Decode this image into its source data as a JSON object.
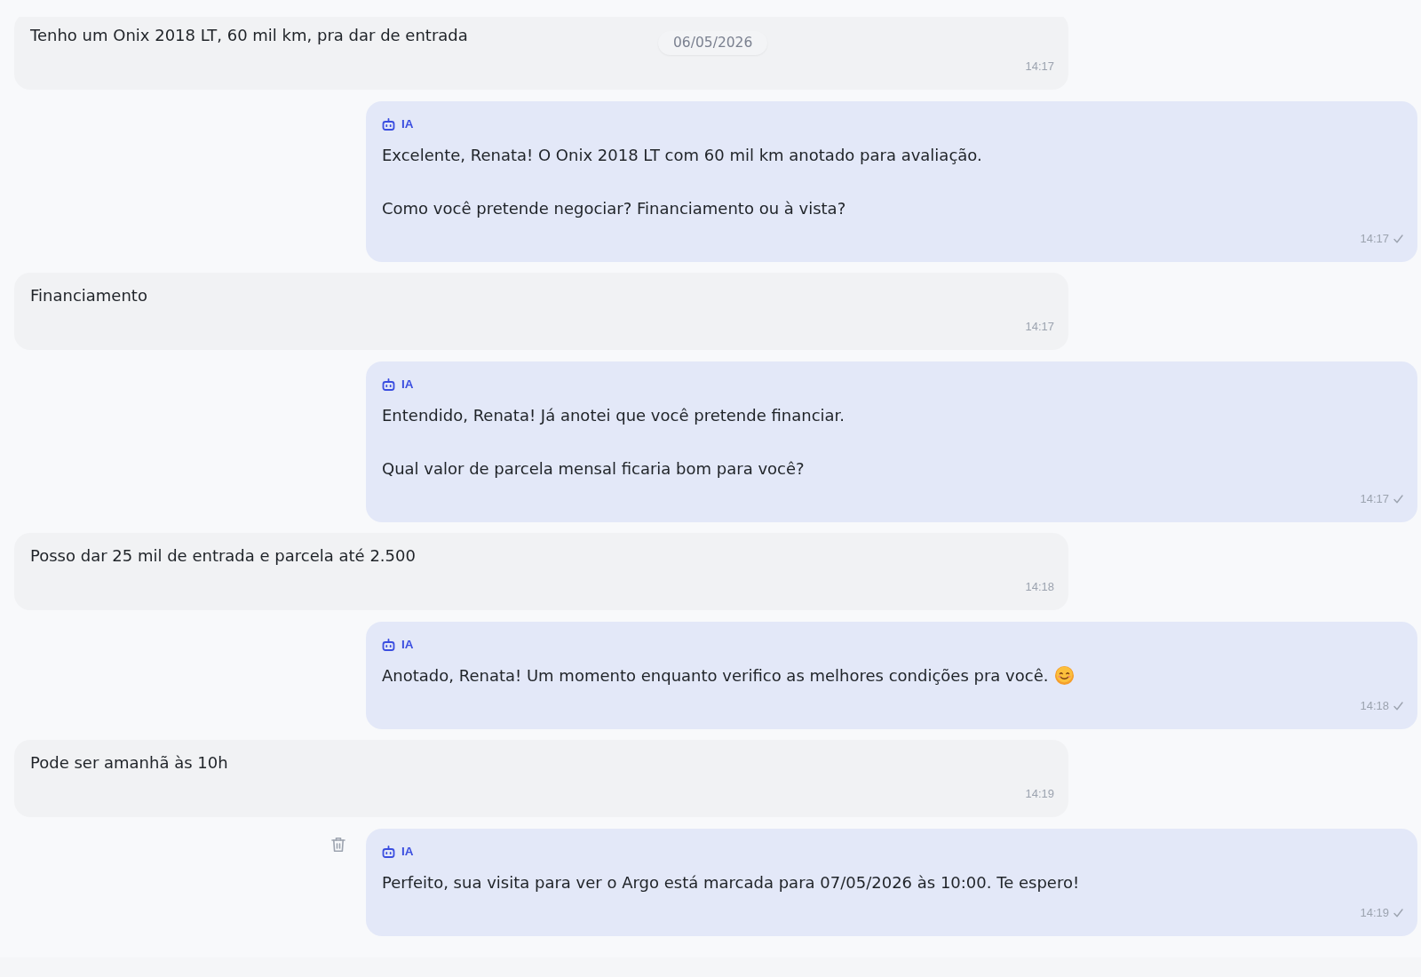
{
  "date_badge": "06/05/2026",
  "messages": [
    {
      "kind": "customer",
      "paragraphs": [
        "Tenho um Onix 2018 LT, 60 mil km, pra dar de entrada"
      ],
      "time": "14:17",
      "sent_check": false,
      "smile_icon": false,
      "delete_visible": false
    },
    {
      "kind": "ai",
      "label": "IA",
      "paragraphs": [
        "Excelente, Renata! O Onix 2018 LT com 60 mil km anotado para avaliação.",
        "Como você pretende negociar? Financiamento ou à vista?"
      ],
      "time": "14:17",
      "sent_check": true,
      "smile_icon": false,
      "delete_visible": false
    },
    {
      "kind": "customer",
      "paragraphs": [
        "Financiamento"
      ],
      "time": "14:17",
      "sent_check": false,
      "smile_icon": false,
      "delete_visible": false
    },
    {
      "kind": "ai",
      "label": "IA",
      "paragraphs": [
        "Entendido, Renata! Já anotei que você pretende financiar.",
        "Qual valor de parcela mensal ficaria bom para você?"
      ],
      "time": "14:17",
      "sent_check": true,
      "smile_icon": false,
      "delete_visible": false
    },
    {
      "kind": "customer",
      "paragraphs": [
        "Posso dar 25 mil de entrada e parcela até 2.500"
      ],
      "time": "14:18",
      "sent_check": false,
      "smile_icon": false,
      "delete_visible": false
    },
    {
      "kind": "ai",
      "label": "IA",
      "paragraphs": [
        "Anotado, Renata! Um momento enquanto verifico as melhores condições pra você."
      ],
      "time": "14:18",
      "sent_check": true,
      "smile_icon": true,
      "delete_visible": false
    },
    {
      "kind": "customer",
      "paragraphs": [
        "Pode ser amanhã às 10h"
      ],
      "time": "14:19",
      "sent_check": false,
      "smile_icon": false,
      "delete_visible": false
    },
    {
      "kind": "ai",
      "label": "IA",
      "paragraphs": [
        "Perfeito, sua visita para ver o Argo está marcada para 07/05/2026 às 10:00. Te espero!"
      ],
      "time": "14:19",
      "sent_check": true,
      "smile_icon": false,
      "delete_visible": true
    }
  ]
}
